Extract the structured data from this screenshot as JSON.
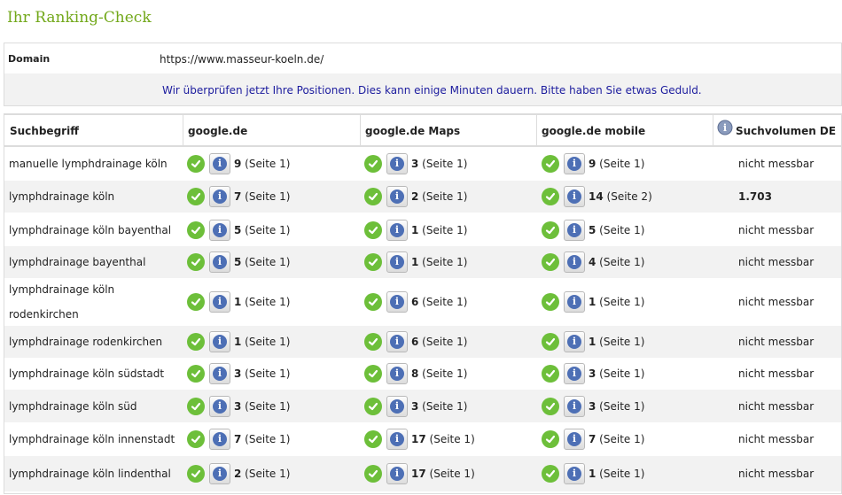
{
  "page_title": "Ihr Ranking-Check",
  "domain": {
    "label": "Domain",
    "value": "https://www.masseur-koeln.de/"
  },
  "notice": "Wir überprüfen jetzt Ihre Positionen. Dies kann einige Minuten dauern. Bitte haben Sie etwas Geduld.",
  "table": {
    "headers": {
      "keyword": "Suchbegriff",
      "google": "google.de",
      "maps": "google.de Maps",
      "mobile": "google.de mobile",
      "volume": "Suchvolumen DE"
    },
    "rows": [
      {
        "keyword": "manuelle lymphdrainage köln",
        "google": {
          "rank": "9",
          "page": "(Seite 1)"
        },
        "maps": {
          "rank": "3",
          "page": "(Seite 1)"
        },
        "mobile": {
          "rank": "9",
          "page": "(Seite 1)"
        },
        "volume": "nicht messbar"
      },
      {
        "keyword": "lymphdrainage köln",
        "google": {
          "rank": "7",
          "page": "(Seite 1)"
        },
        "maps": {
          "rank": "2",
          "page": "(Seite 1)"
        },
        "mobile": {
          "rank": "14",
          "page": "(Seite 2)"
        },
        "volume": "1.703"
      },
      {
        "keyword": "lymphdrainage köln bayenthal",
        "google": {
          "rank": "5",
          "page": "(Seite 1)"
        },
        "maps": {
          "rank": "1",
          "page": "(Seite 1)"
        },
        "mobile": {
          "rank": "5",
          "page": "(Seite 1)"
        },
        "volume": "nicht messbar"
      },
      {
        "keyword": "lymphdrainage bayenthal",
        "google": {
          "rank": "5",
          "page": "(Seite 1)"
        },
        "maps": {
          "rank": "1",
          "page": "(Seite 1)"
        },
        "mobile": {
          "rank": "4",
          "page": "(Seite 1)"
        },
        "volume": "nicht messbar"
      },
      {
        "keyword": "lymphdrainage köln rodenkirchen",
        "google": {
          "rank": "1",
          "page": "(Seite 1)"
        },
        "maps": {
          "rank": "6",
          "page": "(Seite 1)"
        },
        "mobile": {
          "rank": "1",
          "page": "(Seite 1)"
        },
        "volume": "nicht messbar"
      },
      {
        "keyword": "lymphdrainage rodenkirchen",
        "google": {
          "rank": "1",
          "page": "(Seite 1)"
        },
        "maps": {
          "rank": "6",
          "page": "(Seite 1)"
        },
        "mobile": {
          "rank": "1",
          "page": "(Seite 1)"
        },
        "volume": "nicht messbar"
      },
      {
        "keyword": "lymphdrainage köln südstadt",
        "google": {
          "rank": "3",
          "page": "(Seite 1)"
        },
        "maps": {
          "rank": "8",
          "page": "(Seite 1)"
        },
        "mobile": {
          "rank": "3",
          "page": "(Seite 1)"
        },
        "volume": "nicht messbar"
      },
      {
        "keyword": "lymphdrainage köln süd",
        "google": {
          "rank": "3",
          "page": "(Seite 1)"
        },
        "maps": {
          "rank": "3",
          "page": "(Seite 1)"
        },
        "mobile": {
          "rank": "3",
          "page": "(Seite 1)"
        },
        "volume": "nicht messbar"
      },
      {
        "keyword": "lymphdrainage köln innenstadt",
        "google": {
          "rank": "7",
          "page": "(Seite 1)"
        },
        "maps": {
          "rank": "17",
          "page": "(Seite 1)"
        },
        "mobile": {
          "rank": "7",
          "page": "(Seite 1)"
        },
        "volume": "nicht messbar"
      },
      {
        "keyword": "lymphdrainage köln lindenthal",
        "google": {
          "rank": "2",
          "page": "(Seite 1)"
        },
        "maps": {
          "rank": "17",
          "page": "(Seite 1)"
        },
        "mobile": {
          "rank": "1",
          "page": "(Seite 1)"
        },
        "volume": "nicht messbar"
      }
    ]
  },
  "icons": {
    "status": "check-circle-icon",
    "details": "info-icon",
    "header_info": "info-icon"
  },
  "colors": {
    "title": "#72a81a",
    "check": "#6dbf3a",
    "info": "#4d6fb5",
    "notice": "#1c1c9e",
    "alt_row": "#f2f2f2"
  }
}
